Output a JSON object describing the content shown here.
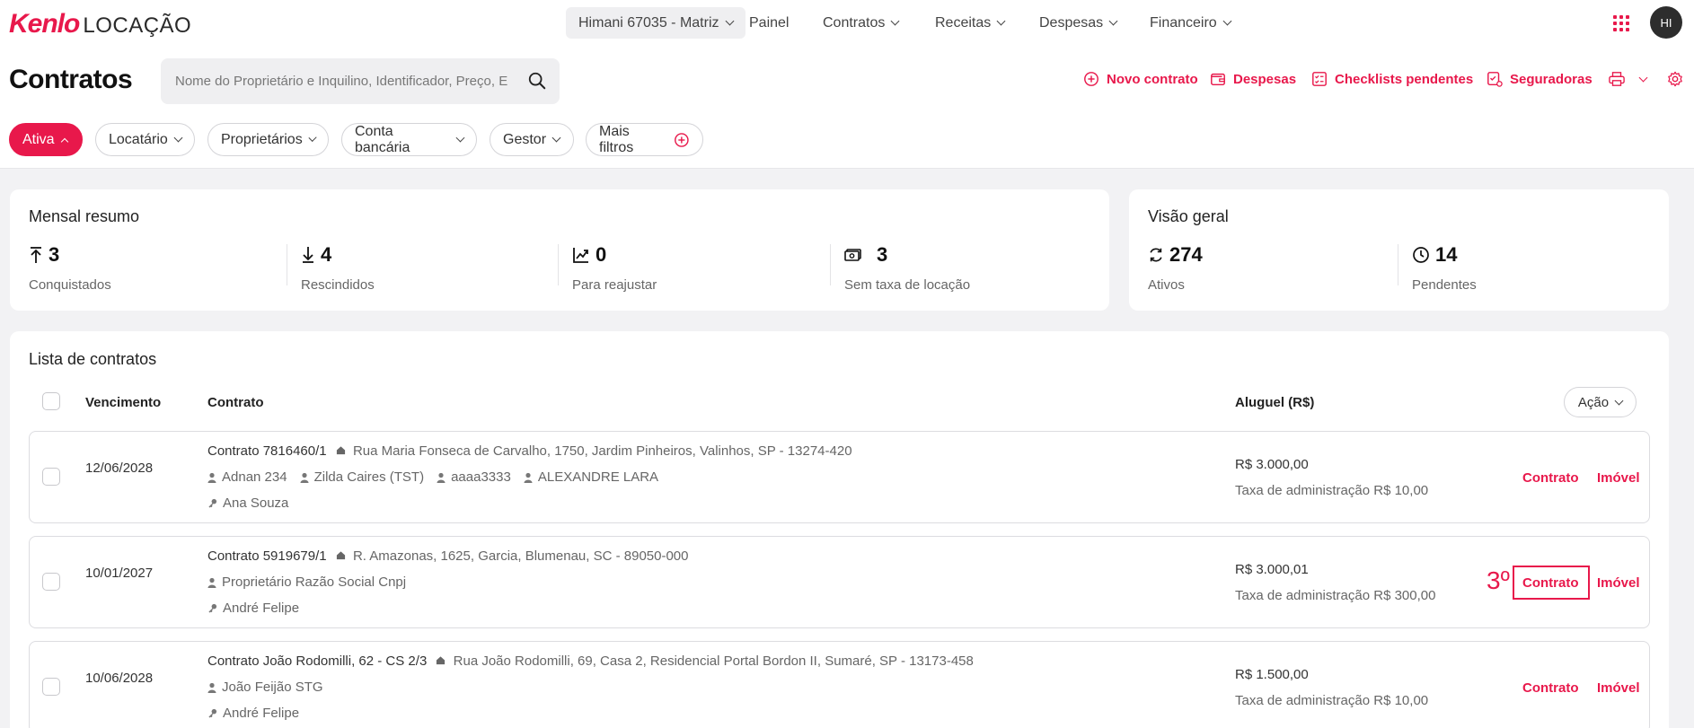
{
  "header": {
    "brand": "Kenlo",
    "brand_sub": "LOCAÇÃO",
    "branch": "Himani 67035 - Matriz",
    "nav": [
      "Painel",
      "Contratos",
      "Receitas",
      "Despesas",
      "Financeiro"
    ],
    "avatar": "HI"
  },
  "page": {
    "title": "Contratos",
    "search_placeholder": "Nome do Proprietário e Inquilino, Identificador, Preço, E",
    "actions": [
      "Novo contrato",
      "Despesas",
      "Checklists pendentes",
      "Seguradoras"
    ]
  },
  "filters": [
    "Ativa",
    "Locatário",
    "Proprietários",
    "Conta bancária",
    "Gestor",
    "Mais filtros"
  ],
  "summary": {
    "title": "Mensal resumo",
    "stats": [
      {
        "value": "3",
        "label": "Conquistados",
        "icon": "arrow-up-bar-icon"
      },
      {
        "value": "4",
        "label": "Rescindidos",
        "icon": "arrow-down-bar-icon"
      },
      {
        "value": "0",
        "label": "Para reajustar",
        "icon": "trend-up-icon"
      },
      {
        "value": "3",
        "label": "Sem taxa de locação",
        "icon": "money-icon"
      }
    ]
  },
  "overview": {
    "title": "Visão geral",
    "stats": [
      {
        "value": "274",
        "label": "Ativos",
        "icon": "refresh-icon"
      },
      {
        "value": "14",
        "label": "Pendentes",
        "icon": "clock-icon"
      }
    ]
  },
  "list": {
    "title": "Lista de contratos",
    "columns": {
      "due": "Vencimento",
      "contract": "Contrato",
      "rent": "Aluguel (R$)"
    },
    "action_button": "Ação",
    "rows": [
      {
        "due": "12/06/2028",
        "contract": "Contrato 7816460/1",
        "address": "Rua Maria Fonseca de Carvalho, 1750, Jardim Pinheiros, Valinhos, SP - 13274-420",
        "people": [
          "Adnan 234",
          "Zilda Caires (TST)",
          "aaaa3333",
          "ALEXANDRE LARA"
        ],
        "manager": "Ana Souza",
        "rent": "R$ 3.000,00",
        "fee": "Taxa de administração R$ 10,00",
        "link_contract": "Contrato",
        "link_property": "Imóvel"
      },
      {
        "due": "10/01/2027",
        "contract": "Contrato 5919679/1",
        "address": "R. Amazonas, 1625, Garcia, Blumenau, SC - 89050-000",
        "people": [
          "Proprietário Razão Social Cnpj"
        ],
        "manager": "André Felipe",
        "rent": "R$ 3.000,01",
        "fee": "Taxa de administração R$ 300,00",
        "link_contract": "Contrato",
        "link_property": "Imóvel"
      },
      {
        "due": "10/06/2028",
        "contract": "Contrato João Rodomilli, 62 - CS 2/3",
        "address": "Rua João Rodomilli, 69, Casa 2, Residencial Portal Bordon II, Sumaré, SP - 13173-458",
        "people": [
          "João Feijão STG"
        ],
        "manager": "André Felipe",
        "rent": "R$ 1.500,00",
        "fee": "Taxa de administração R$ 10,00",
        "link_contract": "Contrato",
        "link_property": "Imóvel"
      }
    ]
  },
  "annotation": {
    "label": "3º"
  },
  "colors": {
    "accent": "#e8184b",
    "background": "#f2f2f4"
  }
}
